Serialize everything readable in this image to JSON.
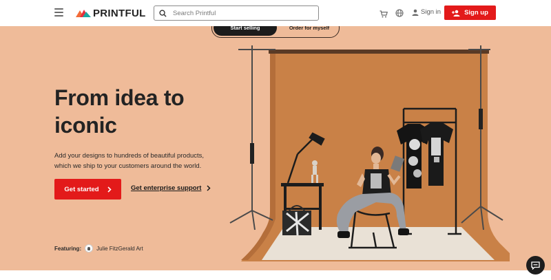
{
  "header": {
    "logo_text": "PRINTFUL",
    "search_placeholder": "Search Printful",
    "signin_label": "Sign in",
    "signup_label": "Sign up",
    "icons": [
      "menu-icon",
      "cart-icon",
      "globe-icon",
      "user-icon",
      "add-user-icon",
      "search-icon"
    ]
  },
  "hero": {
    "toggle": {
      "active": "Start selling",
      "inactive": "Order for myself"
    },
    "headline": "From idea to iconic",
    "subtext": "Add your designs to hundreds of beautiful products, which we ship to your customers around the world.",
    "cta_label": "Get started",
    "enterprise_label": "Get enterprise support",
    "featuring_label": "Featuring:",
    "featuring_name": "Julie FitzGerald Art"
  },
  "colors": {
    "brand_red": "#e31a1a",
    "hero_bg": "#efbb99",
    "backdrop": "#c98147",
    "dark": "#1c1c1c"
  }
}
